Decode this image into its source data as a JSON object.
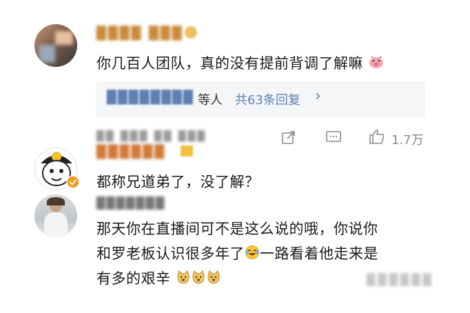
{
  "comments": [
    {
      "author": "████ ███",
      "text": "你几百人团队，真的没有提前背调了解嘛",
      "replies": {
        "names": "████████",
        "suffix": "等人",
        "count_label": "共63条回复",
        "chevron": "›"
      },
      "meta": "██ ███ ██ ███",
      "actions": {
        "share": "share-icon",
        "comment": "comment-icon",
        "like_count": "1.7万"
      }
    },
    {
      "author": "██████",
      "text": "都称兄道弟了，没了解？"
    },
    {
      "author": "███████",
      "text_lines": [
        "那天你在直播间可不是这么说的哦，你说你",
        "和罗老板认识很多年了",
        "一路看着他走来是",
        "有多的艰辛"
      ]
    }
  ],
  "watermark": "██████"
}
